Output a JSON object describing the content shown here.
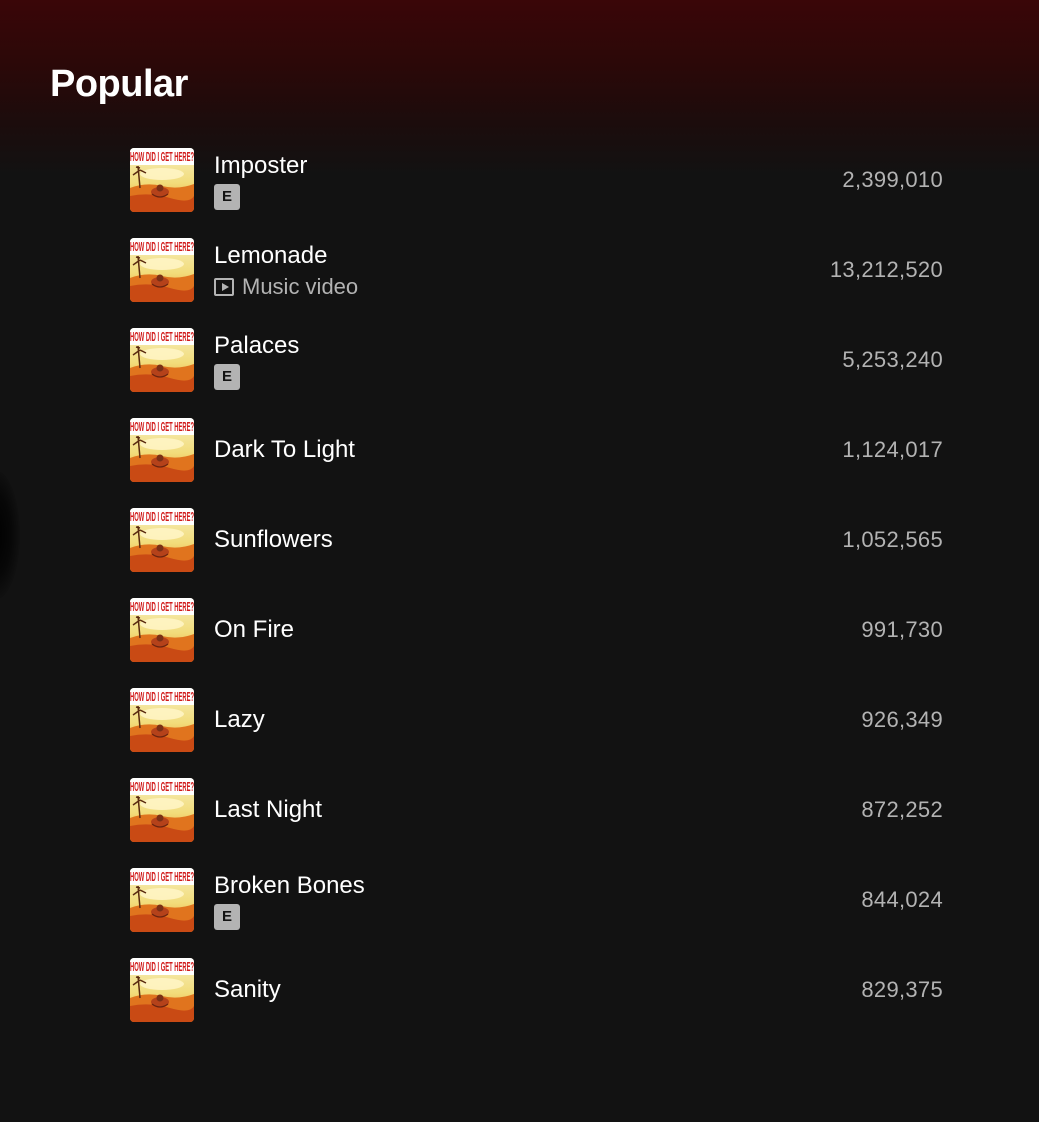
{
  "section": {
    "title": "Popular"
  },
  "tracks": [
    {
      "title": "Imposter",
      "plays": "2,399,010",
      "explicit": true,
      "badge": "E",
      "music_video": false
    },
    {
      "title": "Lemonade",
      "plays": "13,212,520",
      "explicit": false,
      "music_video": true,
      "video_label": "Music video"
    },
    {
      "title": "Palaces",
      "plays": "5,253,240",
      "explicit": true,
      "badge": "E",
      "music_video": false
    },
    {
      "title": "Dark To Light",
      "plays": "1,124,017",
      "explicit": false,
      "music_video": false
    },
    {
      "title": "Sunflowers",
      "plays": "1,052,565",
      "explicit": false,
      "music_video": false
    },
    {
      "title": "On Fire",
      "plays": "991,730",
      "explicit": false,
      "music_video": false
    },
    {
      "title": "Lazy",
      "plays": "926,349",
      "explicit": false,
      "music_video": false
    },
    {
      "title": "Last Night",
      "plays": "872,252",
      "explicit": false,
      "music_video": false
    },
    {
      "title": "Broken Bones",
      "plays": "844,024",
      "explicit": true,
      "badge": "E",
      "music_video": false
    },
    {
      "title": "Sanity",
      "plays": "829,375",
      "explicit": false,
      "music_video": false
    }
  ],
  "cover_art": {
    "text": "HOW DID I GET HERE?"
  },
  "colors": {
    "background": "#121212",
    "header_gradient": "#3a0608",
    "text_primary": "#ffffff",
    "text_secondary": "#b3b3b3"
  },
  "icons": {
    "explicit": "explicit-badge-icon",
    "video": "music-video-icon"
  }
}
